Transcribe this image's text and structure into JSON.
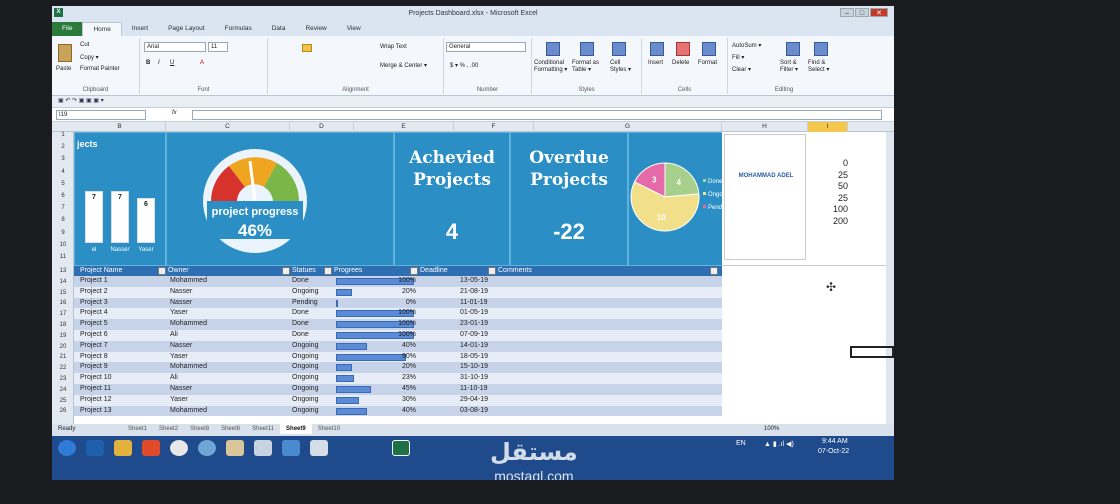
{
  "window": {
    "title": "Projects Dashboard.xlsx - Microsoft Excel",
    "app_icon": "X"
  },
  "tabs": [
    "File",
    "Home",
    "Insert",
    "Page Layout",
    "Formulas",
    "Data",
    "Review",
    "View"
  ],
  "ribbon": {
    "clipboard": {
      "paste": "Paste",
      "cut": "Cut",
      "copy": "Copy ▾",
      "painter": "Format Painter",
      "label": "Clipboard"
    },
    "font": {
      "name": "Arial",
      "size": "11",
      "label": "Font"
    },
    "alignment": {
      "wrap": "Wrap Text",
      "merge": "Merge & Center ▾",
      "label": "Alignment"
    },
    "number": {
      "format": "General",
      "label": "Number"
    },
    "styles": {
      "cond": "Conditional Formatting ▾",
      "table": "Format as Table ▾",
      "cell": "Cell Styles ▾",
      "label": "Styles"
    },
    "cells": {
      "insert": "Insert",
      "delete": "Delete",
      "format": "Format",
      "label": "Cells"
    },
    "editing": {
      "autosum": "AutoSum ▾",
      "fill": "Fill ▾",
      "clear": "Clear ▾",
      "sort": "Sort & Filter ▾",
      "find": "Find & Select ▾",
      "label": "Editing"
    }
  },
  "name_box": "I19",
  "columns": [
    "B",
    "C",
    "D",
    "E",
    "F",
    "G",
    "H",
    "I"
  ],
  "rows": [
    "1",
    "2",
    "3",
    "4",
    "5",
    "6",
    "7",
    "8",
    "9",
    "10",
    "11",
    "13",
    "14",
    "15",
    "16",
    "17",
    "18",
    "19",
    "20",
    "21",
    "22",
    "23",
    "24",
    "25",
    "26"
  ],
  "dashboard": {
    "projects_title": "jects",
    "mini_bars": [
      {
        "label": "el",
        "value": 7
      },
      {
        "label": "Nasser",
        "value": 7
      },
      {
        "label": "Yaser",
        "value": 6
      }
    ],
    "gauge": {
      "label": "project progress",
      "value": "46%",
      "fraction": 0.46
    },
    "achieved": {
      "title": "Achevied Projects",
      "value": "4"
    },
    "overdue": {
      "title": "Overdue Projects",
      "value": "-22"
    },
    "pie": {
      "slices": [
        {
          "label": "Done",
          "value": 4,
          "color": "#a7d08c"
        },
        {
          "label": "Ongoing",
          "value": 10,
          "color": "#f1df8a"
        },
        {
          "label": "Pending",
          "value": 3,
          "color": "#e46aa8"
        }
      ]
    },
    "owner_label": "MOHAMMAD ADEL",
    "i_values": [
      "0",
      "25",
      "50",
      "25",
      "100",
      "200"
    ]
  },
  "table": {
    "headers": [
      "Project Name",
      "Owner",
      "Statues",
      "Progrees",
      "Deadline",
      "Comments"
    ],
    "rows": [
      {
        "rn": "14",
        "name": "Project 1",
        "owner": "Mohammed",
        "status": "Done",
        "progress": "100%",
        "p": 1.0,
        "deadline": "13-05-19"
      },
      {
        "rn": "15",
        "name": "Project 2",
        "owner": "Nasser",
        "status": "Ongoing",
        "progress": "20%",
        "p": 0.2,
        "deadline": "21-08-19"
      },
      {
        "rn": "16",
        "name": "Project 3",
        "owner": "Nasser",
        "status": "Pending",
        "progress": "0%",
        "p": 0.0,
        "deadline": "11-01-19"
      },
      {
        "rn": "17",
        "name": "Project 4",
        "owner": "Yaser",
        "status": "Done",
        "progress": "100%",
        "p": 1.0,
        "deadline": "01-05-19"
      },
      {
        "rn": "18",
        "name": "Project 5",
        "owner": "Mohammed",
        "status": "Done",
        "progress": "100%",
        "p": 1.0,
        "deadline": "23-01-19"
      },
      {
        "rn": "19",
        "name": "Project 6",
        "owner": "Ali",
        "status": "Done",
        "progress": "100%",
        "p": 1.0,
        "deadline": "07-09-19"
      },
      {
        "rn": "20",
        "name": "Project 7",
        "owner": "Nasser",
        "status": "Ongoing",
        "progress": "40%",
        "p": 0.4,
        "deadline": "14-01-19"
      },
      {
        "rn": "21",
        "name": "Project 8",
        "owner": "Yaser",
        "status": "Ongoing",
        "progress": "90%",
        "p": 0.9,
        "deadline": "18-05-19"
      },
      {
        "rn": "22",
        "name": "Project 9",
        "owner": "Mohammed",
        "status": "Ongoing",
        "progress": "20%",
        "p": 0.2,
        "deadline": "15-10-19"
      },
      {
        "rn": "23",
        "name": "Project 10",
        "owner": "Ali",
        "status": "Ongoing",
        "progress": "23%",
        "p": 0.23,
        "deadline": "31-10-19"
      },
      {
        "rn": "24",
        "name": "Project 11",
        "owner": "Nasser",
        "status": "Ongoing",
        "progress": "45%",
        "p": 0.45,
        "deadline": "11-10-19"
      },
      {
        "rn": "25",
        "name": "Project 12",
        "owner": "Yaser",
        "status": "Ongoing",
        "progress": "30%",
        "p": 0.3,
        "deadline": "29-04-19"
      },
      {
        "rn": "26",
        "name": "Project 13",
        "owner": "Mohammed",
        "status": "Ongoing",
        "progress": "40%",
        "p": 0.4,
        "deadline": "03-08-19"
      }
    ]
  },
  "sheet_tabs": [
    "Sheet1",
    "Sheet2",
    "Sheet8",
    "Sheet6",
    "Sheet11",
    "Sheet9",
    "Sheet10"
  ],
  "active_sheet": "Sheet9",
  "status": {
    "ready": "Ready",
    "zoom": "100%"
  },
  "taskbar": {
    "lang": "EN",
    "time": "9:44 AM",
    "date": "07-Oct-22"
  },
  "watermark": {
    "logo": "مستقل",
    "url": "mostaql.com"
  }
}
